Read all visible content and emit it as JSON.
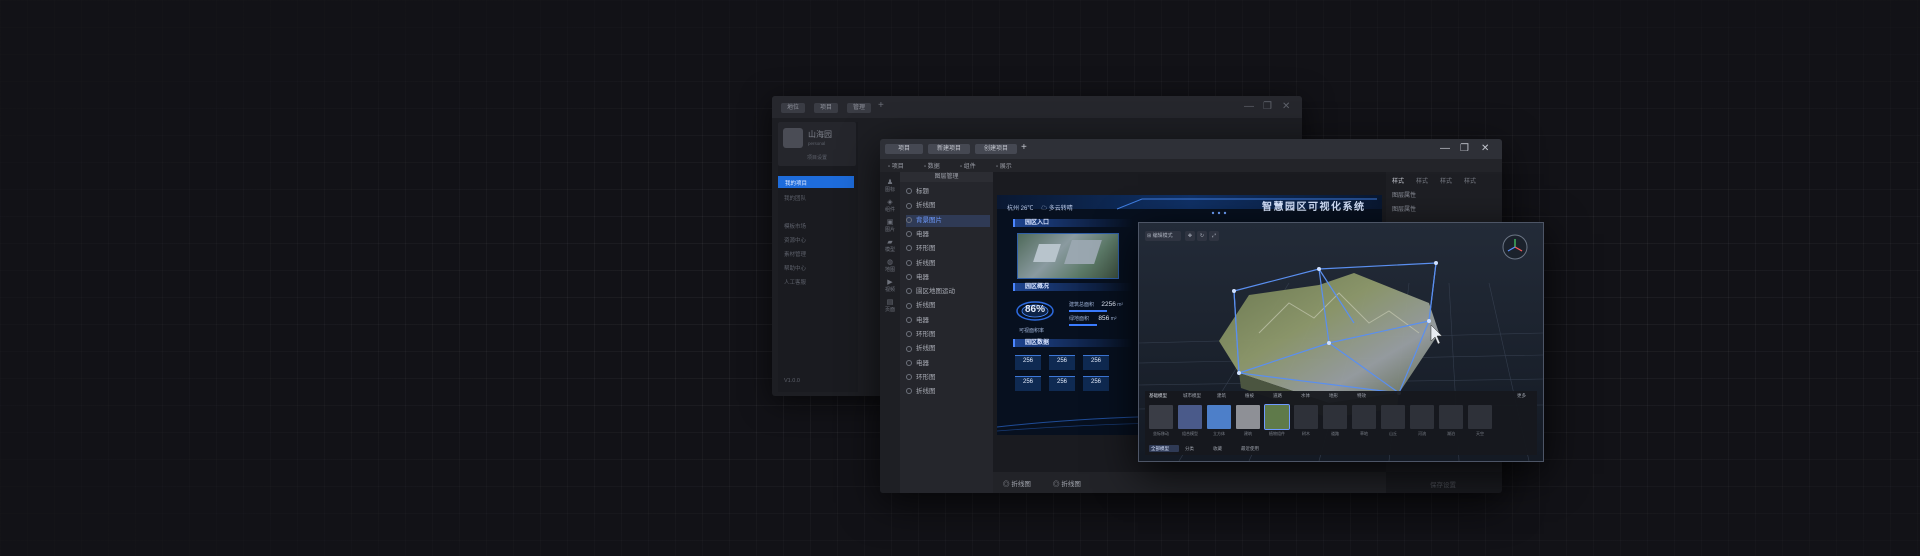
{
  "back_window": {
    "tabs": [
      "地位",
      "项目",
      "管理"
    ],
    "add_tab": "+",
    "project_name": "山海园",
    "project_sub": "personal",
    "project_action": "项目设置",
    "nav": [
      "我的项目",
      "我的团队",
      "模板市场",
      "资源中心",
      "素材管理",
      "帮助中心",
      "人工客服"
    ],
    "version": "V1.0.0"
  },
  "window_controls": {
    "minimize": "—",
    "maximize": "❐",
    "close": "✕"
  },
  "main_window": {
    "tabs": [
      "项目",
      "新建项目",
      "创建项目"
    ],
    "add_tab": "+",
    "menu": [
      "项目",
      "数据",
      "组件",
      "展示"
    ],
    "iconbar": [
      {
        "icon": "person-icon",
        "label": "图标"
      },
      {
        "icon": "layer-icon",
        "label": "组件"
      },
      {
        "icon": "image-icon",
        "label": "图片"
      },
      {
        "icon": "box-icon",
        "label": "模型"
      },
      {
        "icon": "globe-icon",
        "label": "地图"
      },
      {
        "icon": "video-icon",
        "label": "视频"
      },
      {
        "icon": "page-icon",
        "label": "页面"
      }
    ],
    "layer_header": "图层管理",
    "layers": [
      "标题",
      "折线图",
      "背景图片",
      "电器",
      "环形图",
      "折线图",
      "电器",
      "園区地图运动",
      "折线图",
      "电器",
      "环形图",
      "折线图",
      "电器",
      "环形图",
      "折线图"
    ],
    "active_layer_index": 2,
    "right_tabs": [
      "样式",
      "样式",
      "样式",
      "样式"
    ],
    "right_items": [
      "图层属性",
      "图层属性"
    ],
    "bottom_items": [
      "折线图",
      "折线图"
    ],
    "bottom_right": "保存设置"
  },
  "dashboard": {
    "weather": "杭州  26℃",
    "weather_desc": "多云转晴",
    "title": "智慧园区可视化系统",
    "sections": [
      "园区入口",
      "园区概况",
      "园区数据"
    ],
    "gauge_value": "86%",
    "gauge_label": "可视面积率",
    "metrics": [
      {
        "label": "建筑总面积",
        "value": "2256",
        "unit": "m²"
      },
      {
        "label": "绿地面积",
        "value": "856",
        "unit": "m²"
      }
    ],
    "stats": [
      "256",
      "256",
      "256",
      "256",
      "256",
      "256"
    ]
  },
  "viewer": {
    "mode_label": "编辑模式",
    "tool_icons": [
      "move-icon",
      "rotate-icon",
      "scale-icon"
    ],
    "asset_tabs": [
      "基础模型",
      "城市模型",
      "建筑",
      "植被",
      "道路",
      "水体",
      "地形",
      "特效"
    ],
    "asset_more": "更多",
    "assets": [
      "坐标移动",
      "组合模型",
      "立方体",
      "建筑",
      "植物组件",
      "树木",
      "道路",
      "草地",
      "山丘",
      "河流",
      "湖泊",
      "天空"
    ],
    "subtabs": [
      "全部模型",
      "分类",
      "收藏",
      "最近使用"
    ]
  },
  "colors": {
    "accent": "#1e6cdb",
    "bg": "#121217"
  }
}
